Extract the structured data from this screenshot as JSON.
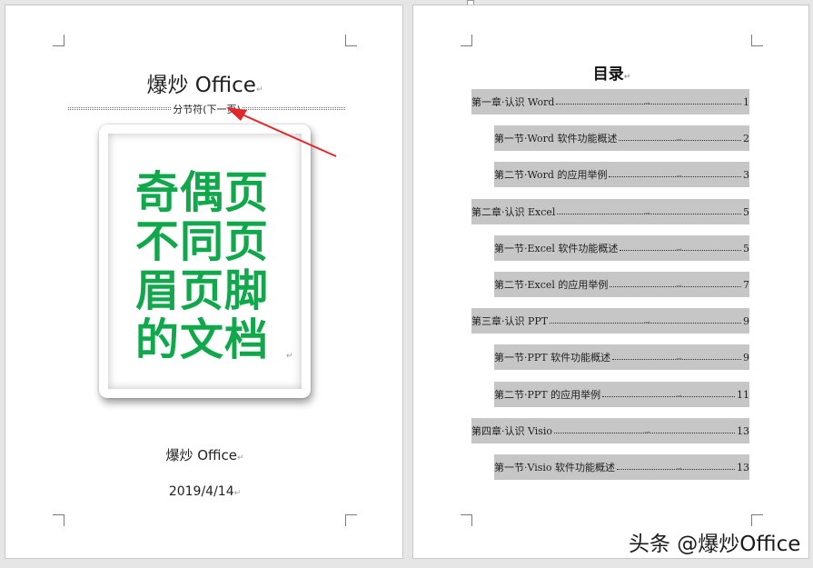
{
  "left_page": {
    "title": "爆炒 Office",
    "section_break": "分节符(下一页)",
    "cover_lines": [
      "奇偶页",
      "不同页",
      "眉页脚",
      "的文档"
    ],
    "author": "爆炒 Office",
    "date": "2019/4/14"
  },
  "right_page": {
    "toc_heading": "目录",
    "entries": [
      {
        "text": "第一章·认识 Word",
        "page": "1",
        "level": 1
      },
      {
        "text": "第一节·Word 软件功能概述",
        "page": "2",
        "level": 2
      },
      {
        "text": "第二节·Word 的应用举例",
        "page": "3",
        "level": 2
      },
      {
        "text": "第二章·认识 Excel",
        "page": "5",
        "level": 1
      },
      {
        "text": "第一节·Excel 软件功能概述",
        "page": "5",
        "level": 2
      },
      {
        "text": "第二节·Excel 的应用举例",
        "page": "7",
        "level": 2
      },
      {
        "text": "第三章·认识 PPT",
        "page": "9",
        "level": 1
      },
      {
        "text": "第一节·PPT 软件功能概述",
        "page": "9",
        "level": 2
      },
      {
        "text": "第二节·PPT 的应用举例",
        "page": "11",
        "level": 2
      },
      {
        "text": "第四章·认识 Visio",
        "page": "13",
        "level": 1
      },
      {
        "text": "第一节·Visio 软件功能概述",
        "page": "13",
        "level": 2
      }
    ]
  },
  "watermark": "头条 @爆炒Office",
  "colors": {
    "cover_text": "#10a84a",
    "arrow": "#e0282a",
    "toc_highlight": "#c6c6c6"
  }
}
